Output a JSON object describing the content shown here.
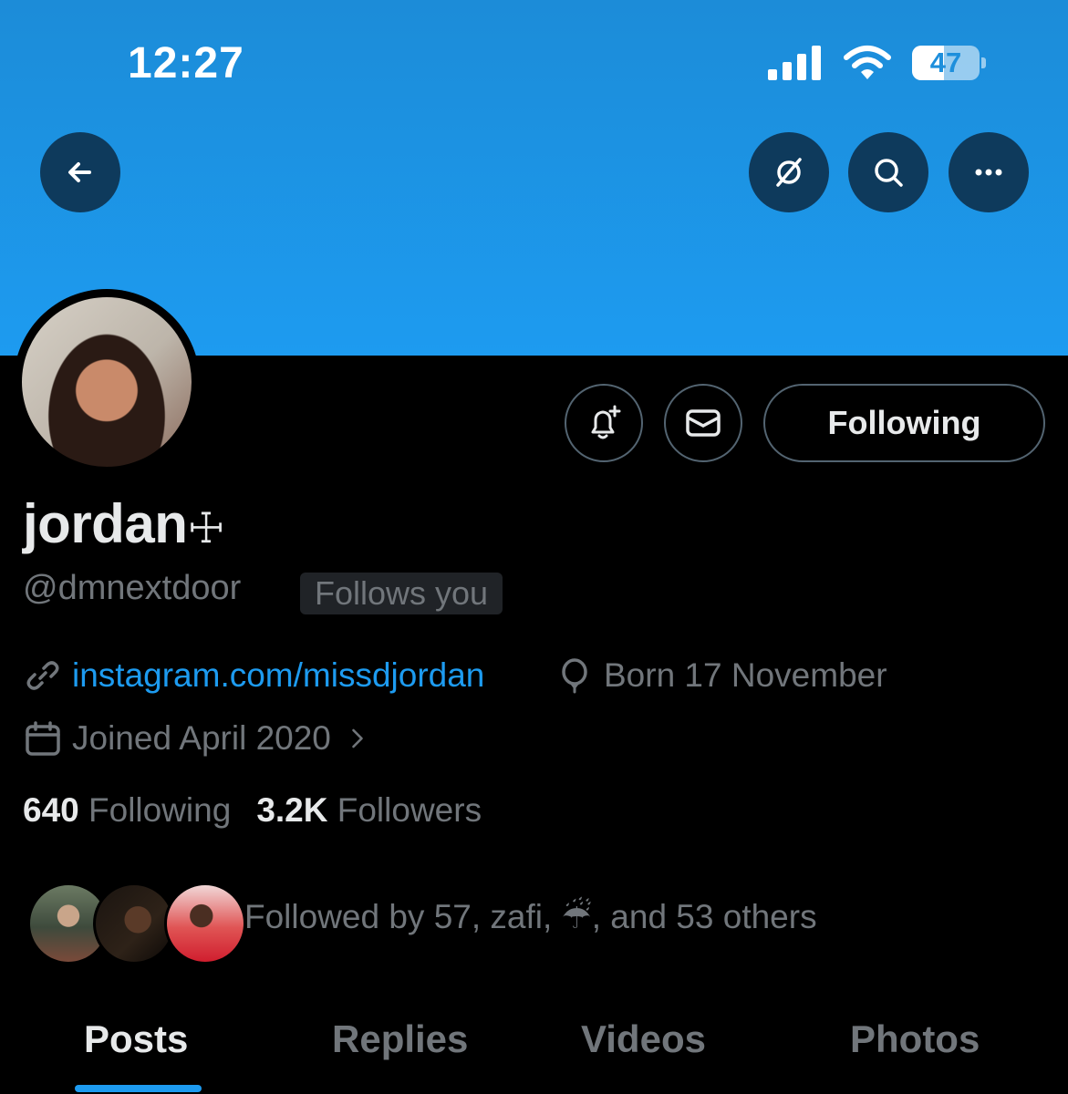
{
  "status_bar": {
    "time": "12:27",
    "battery": "47",
    "battery_level": 0.47
  },
  "header": {
    "back_icon": "arrow-left-icon",
    "grok_icon": "grok-icon",
    "search_icon": "search-icon",
    "more_icon": "more-dots-icon"
  },
  "profile": {
    "name": "jordan",
    "name_suffix": "☩",
    "handle": "@dmnextdoor",
    "follows_you": "Follows you",
    "following_button": "Following",
    "link": "instagram.com/missdjordan",
    "born": "Born 17 November",
    "joined": "Joined April 2020",
    "following_count": "640",
    "following_label": "Following",
    "followers_count": "3.2K",
    "followers_label": "Followers",
    "followed_by": "Followed by 57, zafi, ☔, and 53 others"
  },
  "tabs": [
    {
      "label": "Posts"
    },
    {
      "label": "Replies"
    },
    {
      "label": "Videos"
    },
    {
      "label": "Photos"
    }
  ],
  "colors": {
    "banner": "#1d9bf0",
    "accent": "#1d9bf0",
    "background": "#000000",
    "muted_text": "#71767b"
  }
}
